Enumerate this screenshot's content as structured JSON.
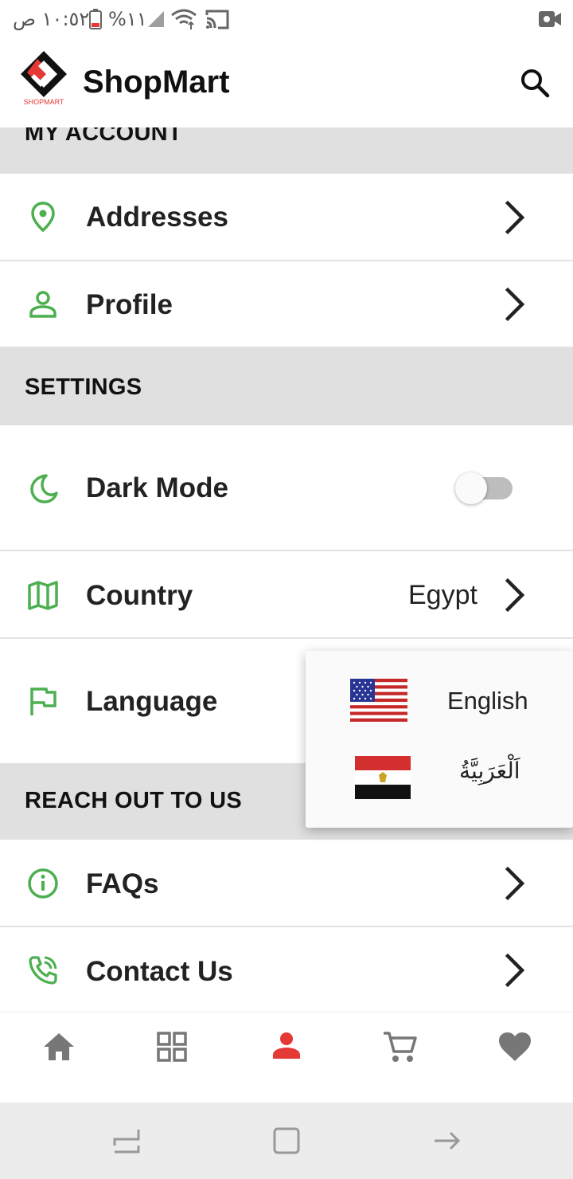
{
  "status_bar": {
    "time": "١٠:٥٢ ص",
    "battery": "%١١"
  },
  "app_bar": {
    "logo_text": "SHOPMART",
    "title": "ShopMart"
  },
  "sections": {
    "account": "MY ACCOUNT",
    "settings": "SETTINGS",
    "reach": "REACH OUT TO US"
  },
  "rows": {
    "addresses": "Addresses",
    "profile": "Profile",
    "dark_mode": "Dark Mode",
    "country": "Country",
    "country_value": "Egypt",
    "language": "Language",
    "faqs": "FAQs",
    "contact": "Contact Us"
  },
  "dark_mode_enabled": false,
  "language_menu": {
    "options": [
      {
        "label": "English",
        "flag": "us-flag"
      },
      {
        "label": "اَلْعَرَبِيَّةُ",
        "flag": "egypt-flag"
      }
    ]
  },
  "bottom_nav": {
    "items": [
      "home-icon",
      "categories-icon",
      "profile-icon",
      "cart-icon",
      "favorites-icon"
    ],
    "active": "profile-icon"
  },
  "colors": {
    "accent_green": "#4caf50",
    "active_red": "#e53935",
    "inactive_gray": "#777777",
    "section_bg": "#e0e0e0"
  }
}
